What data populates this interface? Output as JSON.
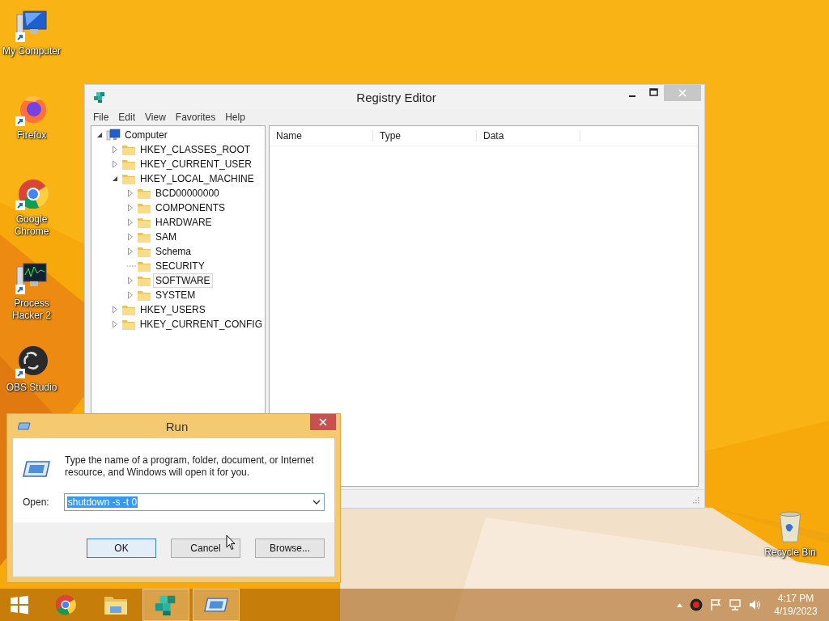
{
  "desktop_icons": [
    {
      "label": "My Computer",
      "kind": "computer"
    },
    {
      "label": "Firefox",
      "kind": "firefox"
    },
    {
      "label": "Google Chrome",
      "kind": "chrome"
    },
    {
      "label": "Process Hacker 2",
      "kind": "monitor"
    },
    {
      "label": "OBS Studio",
      "kind": "obs"
    }
  ],
  "recycle_bin": {
    "label": "Recycle Bin"
  },
  "registry_editor": {
    "title": "Registry Editor",
    "menu": [
      "File",
      "Edit",
      "View",
      "Favorites",
      "Help"
    ],
    "tree": {
      "label": "Computer",
      "expandable": true,
      "expanded": true,
      "selected": false,
      "children": [
        {
          "label": "HKEY_CLASSES_ROOT",
          "expandable": true,
          "expanded": false,
          "selected": false
        },
        {
          "label": "HKEY_CURRENT_USER",
          "expandable": true,
          "expanded": false,
          "selected": false
        },
        {
          "label": "HKEY_LOCAL_MACHINE",
          "expandable": true,
          "expanded": true,
          "selected": false,
          "children": [
            {
              "label": "BCD00000000",
              "expandable": true,
              "expanded": false,
              "selected": false
            },
            {
              "label": "COMPONENTS",
              "expandable": true,
              "expanded": false,
              "selected": false
            },
            {
              "label": "HARDWARE",
              "expandable": true,
              "expanded": false,
              "selected": false
            },
            {
              "label": "SAM",
              "expandable": true,
              "expanded": false,
              "selected": false
            },
            {
              "label": "Schema",
              "expandable": true,
              "expanded": false,
              "selected": false
            },
            {
              "label": "SECURITY",
              "expandable": false,
              "expanded": false,
              "selected": false
            },
            {
              "label": "SOFTWARE",
              "expandable": true,
              "expanded": false,
              "selected": true
            },
            {
              "label": "SYSTEM",
              "expandable": true,
              "expanded": false,
              "selected": false
            }
          ]
        },
        {
          "label": "HKEY_USERS",
          "expandable": true,
          "expanded": false,
          "selected": false
        },
        {
          "label": "HKEY_CURRENT_CONFIG",
          "expandable": true,
          "expanded": false,
          "selected": false
        }
      ]
    },
    "columns": [
      "Name",
      "Type",
      "Data"
    ]
  },
  "run_dialog": {
    "title": "Run",
    "description": "Type the name of a program, folder, document, or Internet resource, and Windows will open it for you.",
    "open_label": "Open:",
    "value": "shutdown -s -t 0",
    "buttons": [
      {
        "label": "OK",
        "selected": true
      },
      {
        "label": "Cancel",
        "selected": false
      },
      {
        "label": "Browse...",
        "selected": false
      }
    ]
  },
  "taskbar": {
    "items": [
      {
        "kind": "start",
        "open": false
      },
      {
        "kind": "chrome",
        "open": false
      },
      {
        "kind": "explorer",
        "open": false
      },
      {
        "kind": "regedit",
        "open": true
      },
      {
        "kind": "run",
        "open": true
      }
    ],
    "tray": [
      {
        "kind": "caret"
      },
      {
        "kind": "obs"
      },
      {
        "kind": "flag"
      },
      {
        "kind": "network"
      },
      {
        "kind": "volume"
      }
    ],
    "time": "4:17 PM",
    "date": "4/19/2023"
  }
}
